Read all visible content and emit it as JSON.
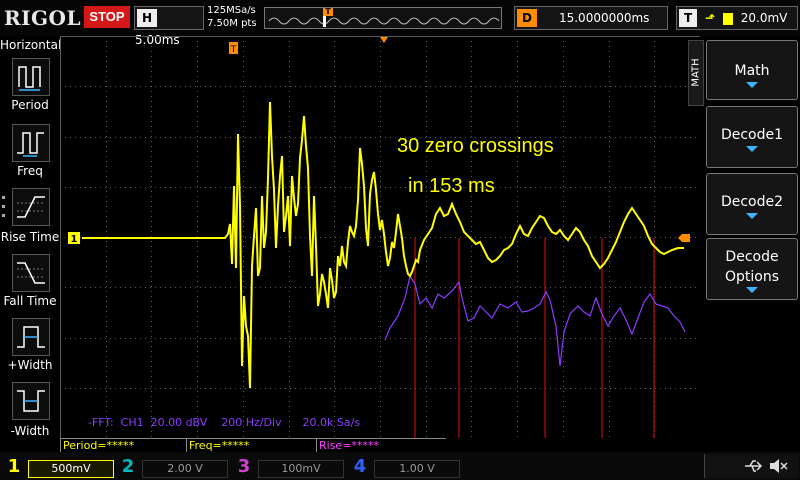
{
  "header": {
    "brand": "RIGOL",
    "run_state": "STOP",
    "timebase_key": "H",
    "timebase_value": "5.00ms",
    "sample_rate": "125MSa/s",
    "memory_depth": "7.50M pts",
    "delay_key": "D",
    "delay_value": "15.0000000ms",
    "trigger_key": "T",
    "trigger_level": "20.0mV",
    "trigger_marker": "T"
  },
  "left_panel": {
    "title": "Horizontal",
    "items": [
      {
        "label": "Period",
        "icon": "period-icon"
      },
      {
        "label": "Freq",
        "icon": "frequency-icon"
      },
      {
        "label": "Rise Time",
        "icon": "rise-time-icon"
      },
      {
        "label": "Fall Time",
        "icon": "fall-time-icon"
      },
      {
        "label": "+Width",
        "icon": "positive-width-icon"
      },
      {
        "label": "-Width",
        "icon": "negative-width-icon"
      }
    ]
  },
  "right_menu": {
    "tab_label": "MATH",
    "buttons": [
      {
        "label_line1": "Math",
        "label_line2": ""
      },
      {
        "label_line1": "Decode1",
        "label_line2": ""
      },
      {
        "label_line1": "Decode2",
        "label_line2": ""
      },
      {
        "label_line1": "Decode",
        "label_line2": "Options"
      }
    ]
  },
  "annotation": {
    "line1": "30 zero crossings",
    "line2": "in 153 ms"
  },
  "fft_info": {
    "text": "-FFT:  CH1  20.00 dBV    200 Hz/Div      20.0k Sa/s"
  },
  "channel1_marker": "1",
  "measurements": [
    {
      "text": "Period=*****",
      "color": "#ffff00"
    },
    {
      "text": "Freq=*****",
      "color": "#ffff00"
    },
    {
      "text": "Rise=*****",
      "color": "#ff44ff"
    }
  ],
  "channels": [
    {
      "num": "1",
      "scale": "500mV",
      "color": "#ffff00",
      "active": true
    },
    {
      "num": "2",
      "scale": "2.00 V",
      "color": "#00b8b8",
      "active": false
    },
    {
      "num": "3",
      "scale": "100mV",
      "color": "#d040d0",
      "active": false
    },
    {
      "num": "4",
      "scale": "1.00 V",
      "color": "#3060ff",
      "active": false
    }
  ],
  "colors": {
    "ch1": "#ffff00",
    "fft": "#8a3cff",
    "cursor_lines": "#e01010",
    "grid": "#5a5a5a",
    "accent_blue": "#3fb5ff",
    "stop_red": "#d41717",
    "trigger_orange": "#ff8c00"
  },
  "icons": {
    "usb": "usb-icon",
    "speaker": "speaker-muted-icon"
  }
}
